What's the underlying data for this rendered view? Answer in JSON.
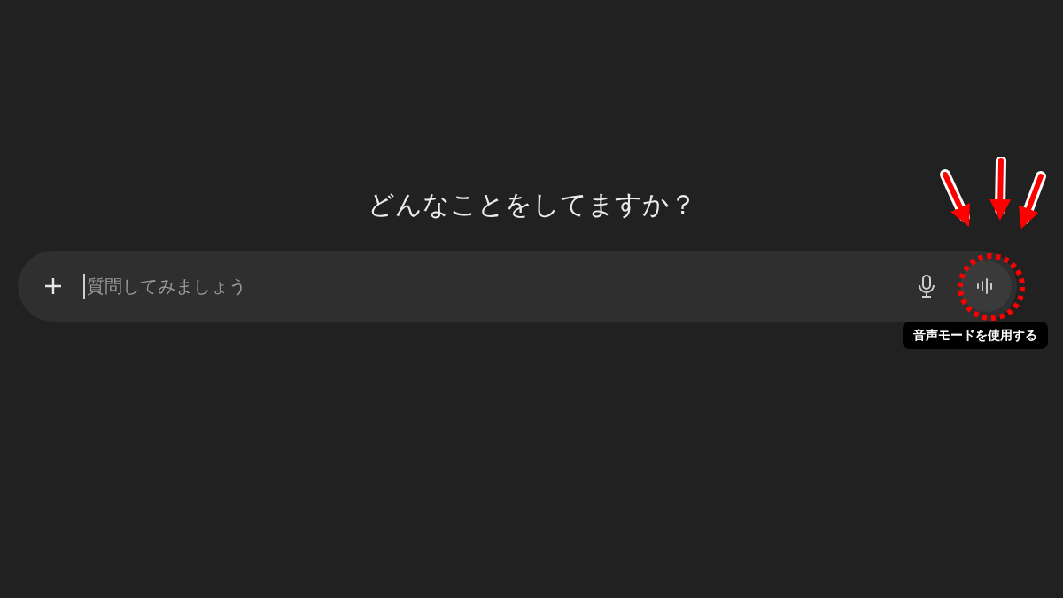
{
  "heading": "どんなことをしてますか？",
  "composer": {
    "placeholder": "質問してみましょう"
  },
  "voice_button": {
    "tooltip": "音声モードを使用する"
  }
}
